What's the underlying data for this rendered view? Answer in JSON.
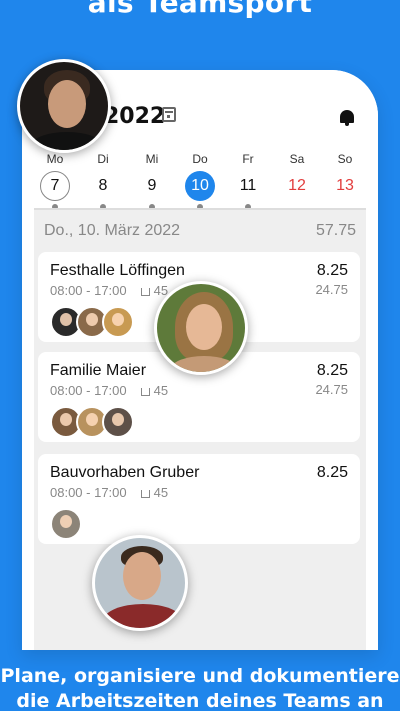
{
  "headline": "als Teamsport",
  "header": {
    "year_label": "2022",
    "calendar_icon": "calendar-icon",
    "bell_icon": "bell-icon"
  },
  "week": [
    {
      "name": "Mo",
      "num": "7",
      "state": "today",
      "dot": true
    },
    {
      "name": "Di",
      "num": "8",
      "state": "normal",
      "dot": true
    },
    {
      "name": "Mi",
      "num": "9",
      "state": "normal",
      "dot": true
    },
    {
      "name": "Do",
      "num": "10",
      "state": "selected",
      "dot": true
    },
    {
      "name": "Fr",
      "num": "11",
      "state": "normal",
      "dot": true
    },
    {
      "name": "Sa",
      "num": "12",
      "state": "weekend",
      "dot": false
    },
    {
      "name": "So",
      "num": "13",
      "state": "weekend",
      "dot": false
    }
  ],
  "day_summary": {
    "date": "Do., 10. März 2022",
    "total": "57.75"
  },
  "cards": [
    {
      "title": "Festhalle Löffingen",
      "time": "08:00 - 17:00",
      "break": "45",
      "hours": "8.25",
      "sub_hours": "24.75",
      "avatar_count": 3
    },
    {
      "title": "Familie Maier",
      "time": "08:00 - 17:00",
      "break": "45",
      "hours": "8.25",
      "sub_hours": "24.75",
      "avatar_count": 3
    },
    {
      "title": "Bauvorhaben Gruber",
      "time": "08:00 - 17:00",
      "break": "45",
      "hours": "8.25",
      "sub_hours": "",
      "avatar_count": 1
    }
  ],
  "bottom_text_line1": "Plane, organisiere und dokumentiere",
  "bottom_text_line2": "die Arbeitszeiten deines Teams an",
  "colors": {
    "brand_blue": "#1f86ec",
    "weekend_red": "#e23d3d"
  }
}
